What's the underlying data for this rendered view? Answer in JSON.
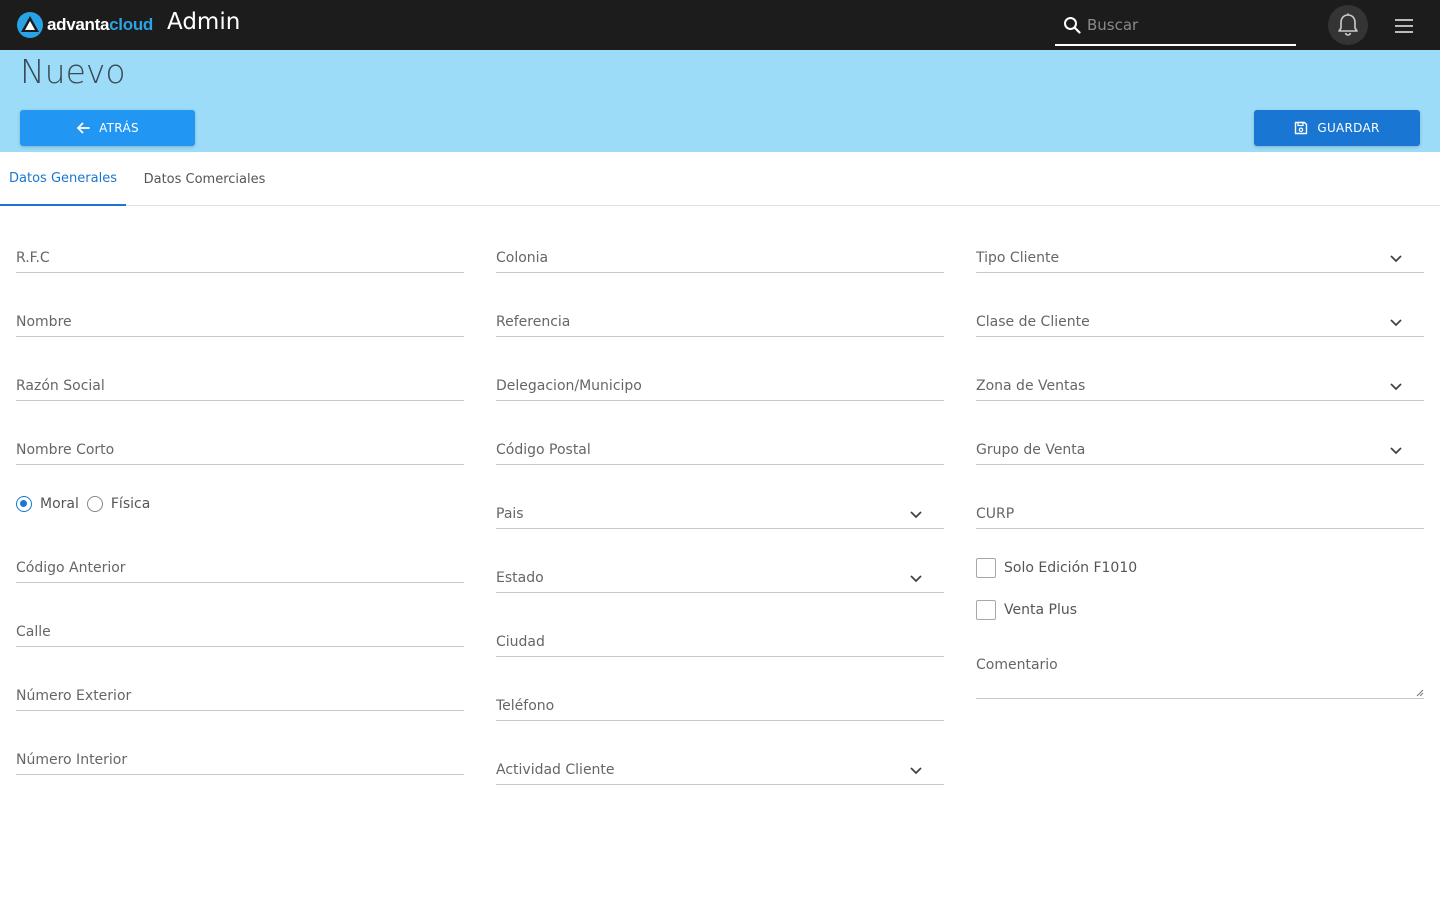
{
  "header": {
    "logo_part1": "advanta",
    "logo_part2": "cloud",
    "app_title": "Admin",
    "search_placeholder": "Buscar",
    "icons": [
      "search-icon",
      "bell-icon",
      "hamburger-menu-icon"
    ]
  },
  "hero": {
    "page_title": "Nuevo",
    "back_label": "ATRÁS",
    "save_label": "GUARDAR"
  },
  "tabs": [
    {
      "label": "Datos Generales",
      "active": true
    },
    {
      "label": "Datos Comerciales",
      "active": false
    }
  ],
  "form": {
    "rfc": "R.F.C",
    "nombre": "Nombre",
    "razon_social": "Razón Social",
    "nombre_corto": "Nombre Corto",
    "radio_moral": "Moral",
    "radio_fisica": "Física",
    "codigo_anterior": "Código Anterior",
    "calle": "Calle",
    "numero_exterior": "Número Exterior",
    "numero_interior": "Número Interior",
    "colonia": "Colonia",
    "referencia": "Referencia",
    "delegacion": "Delegacion/Municipo",
    "codigo_postal": "Código Postal",
    "pais": "Pais",
    "estado": "Estado",
    "ciudad": "Ciudad",
    "telefono": "Teléfono",
    "actividad_cliente": "Actividad Cliente",
    "tipo_cliente": "Tipo Cliente",
    "clase_cliente": "Clase de Cliente",
    "zona_ventas": "Zona de Ventas",
    "grupo_venta": "Grupo de Venta",
    "curp": "CURP",
    "solo_edicion": "Solo Edición F1010",
    "venta_plus": "Venta Plus",
    "comentario": "Comentario"
  },
  "colors": {
    "topbar": "#1c1c1c",
    "hero": "#9cdcf8",
    "primary": "#2196f3",
    "primary_dark": "#1976d2"
  }
}
